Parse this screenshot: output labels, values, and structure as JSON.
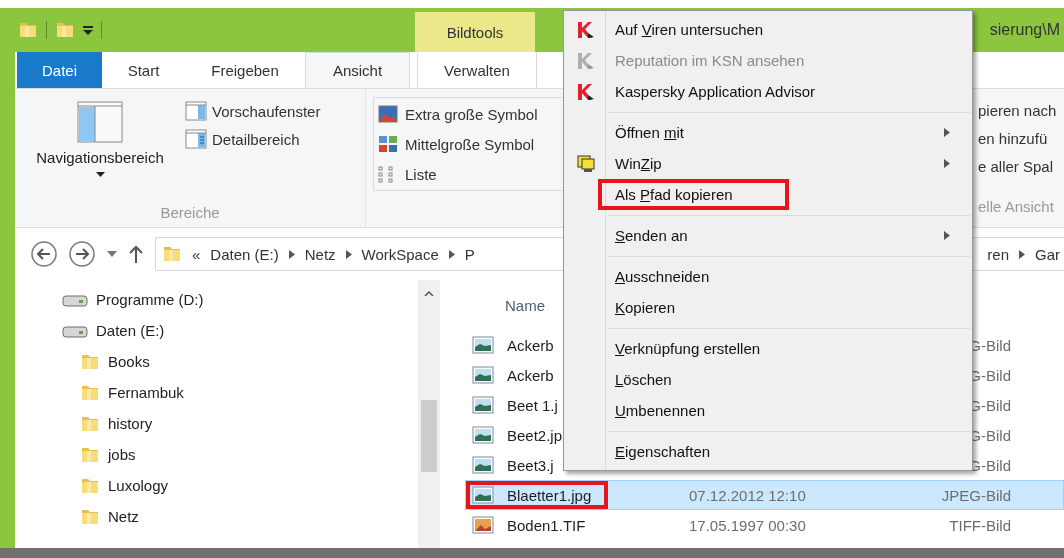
{
  "window": {
    "title": "sierung\\M"
  },
  "contextual_tab": {
    "label": "Bildtools"
  },
  "tabs": [
    {
      "label": "Datei",
      "kind": "file",
      "selected": false
    },
    {
      "label": "Start",
      "kind": "tab",
      "selected": false
    },
    {
      "label": "Freigeben",
      "kind": "tab",
      "selected": false
    },
    {
      "label": "Ansicht",
      "kind": "tab",
      "selected": true
    },
    {
      "label": "Verwalten",
      "kind": "contextual",
      "selected": false
    }
  ],
  "ribbon": {
    "panes_group": {
      "label": "Bereiche",
      "large_button": {
        "label": "Navigationsbereich"
      },
      "buttons": [
        {
          "label": "Vorschaufenster",
          "kind": "preview"
        },
        {
          "label": "Detailbereich",
          "kind": "details"
        }
      ]
    },
    "layout_gallery": [
      {
        "label": "Extra große Symbol",
        "kind": "extra-large"
      },
      {
        "label": "Mittelgroße Symbol",
        "kind": "medium"
      },
      {
        "label": "Liste",
        "kind": "list"
      }
    ],
    "right_group": {
      "items": [
        "pieren nach",
        "en hinzufü",
        "e aller Spal"
      ],
      "label": "elle Ansicht"
    }
  },
  "address_bar": {
    "overflow": "«",
    "path": [
      "Daten (E:)",
      "Netz",
      "WorkSpace",
      "P"
    ],
    "path_end": [
      "ren",
      "Gar"
    ]
  },
  "navigation_pane": {
    "items": [
      {
        "label": "Programme (D:)",
        "kind": "drive"
      },
      {
        "label": "Daten (E:)",
        "kind": "drive",
        "children": [
          {
            "label": "Books",
            "kind": "folder"
          },
          {
            "label": "Fernambuk",
            "kind": "folder"
          },
          {
            "label": "history",
            "kind": "folder"
          },
          {
            "label": "jobs",
            "kind": "folder"
          },
          {
            "label": "Luxology",
            "kind": "folder"
          },
          {
            "label": "Netz",
            "kind": "folder"
          }
        ]
      }
    ]
  },
  "file_list": {
    "columns": [
      "Name"
    ],
    "rows": [
      {
        "name": "Ackerb",
        "type": "G-Bild",
        "kind": "jpeg",
        "selected": false,
        "highlighted": false
      },
      {
        "name": "Ackerb",
        "type": "G-Bild",
        "kind": "jpeg",
        "selected": false,
        "highlighted": false
      },
      {
        "name": "Beet 1.j",
        "type": "G-Bild",
        "kind": "jpeg",
        "selected": false,
        "highlighted": false
      },
      {
        "name": "Beet2.jp",
        "type": "G-Bild",
        "kind": "jpeg",
        "selected": false,
        "highlighted": false
      },
      {
        "name": "Beet3.j",
        "type": "G-Bild",
        "kind": "jpeg",
        "selected": false,
        "highlighted": false
      },
      {
        "name": "Blaetter1.jpg",
        "date": "07.12.2012 12:10",
        "type": "JPEG-Bild",
        "kind": "jpeg",
        "selected": true,
        "highlighted": true
      },
      {
        "name": "Boden1.TIF",
        "date": "17.05.1997 00:30",
        "type": "TIFF-Bild",
        "kind": "tiff",
        "selected": false,
        "highlighted": false
      }
    ]
  },
  "context_menu": {
    "items": [
      {
        "kind": "kaspersky-item",
        "label_start": "Auf ",
        "accesskey": "V",
        "label_end": "iren untersuchen",
        "disabled": false,
        "submenu": false,
        "highlighted": false
      },
      {
        "kind": "kaspersky-item",
        "label_start": "Reputation im KSN ansehen",
        "disabled": true,
        "submenu": false,
        "highlighted": false
      },
      {
        "kind": "kaspersky-item",
        "label_start": "Kaspersky Application Advisor",
        "disabled": false,
        "submenu": false,
        "highlighted": false
      },
      {
        "kind": "separator"
      },
      {
        "kind": "item",
        "label_start": "Öffnen ",
        "accesskey": "m",
        "label_end": "it",
        "disabled": false,
        "submenu": true,
        "highlighted": false
      },
      {
        "kind": "winzip-item",
        "label_start": "Win",
        "accesskey": "Z",
        "label_end": "ip",
        "disabled": false,
        "submenu": true,
        "highlighted": false
      },
      {
        "kind": "item",
        "label_start": "Als ",
        "accesskey": "P",
        "label_end": "fad kopieren",
        "disabled": false,
        "submenu": false,
        "highlighted": true
      },
      {
        "kind": "separator"
      },
      {
        "kind": "item",
        "accesskey": "S",
        "label_end": "enden an",
        "disabled": false,
        "submenu": true,
        "highlighted": false
      },
      {
        "kind": "separator"
      },
      {
        "kind": "item",
        "accesskey": "A",
        "label_end": "usschneiden",
        "disabled": false,
        "submenu": false,
        "highlighted": false
      },
      {
        "kind": "item",
        "accesskey": "K",
        "label_end": "opieren",
        "disabled": false,
        "submenu": false,
        "highlighted": false
      },
      {
        "kind": "separator"
      },
      {
        "kind": "item",
        "accesskey": "V",
        "label_end": "erknüpfung erstellen",
        "disabled": false,
        "submenu": false,
        "highlighted": false
      },
      {
        "kind": "item",
        "accesskey": "L",
        "label_end": "öschen",
        "disabled": false,
        "submenu": false,
        "highlighted": false
      },
      {
        "kind": "item",
        "accesskey": "U",
        "label_end": "mbenennen",
        "disabled": false,
        "submenu": false,
        "highlighted": false
      },
      {
        "kind": "separator"
      },
      {
        "kind": "item",
        "accesskey": "E",
        "label_end": "igenschaften",
        "disabled": false,
        "submenu": false,
        "highlighted": false
      }
    ]
  }
}
